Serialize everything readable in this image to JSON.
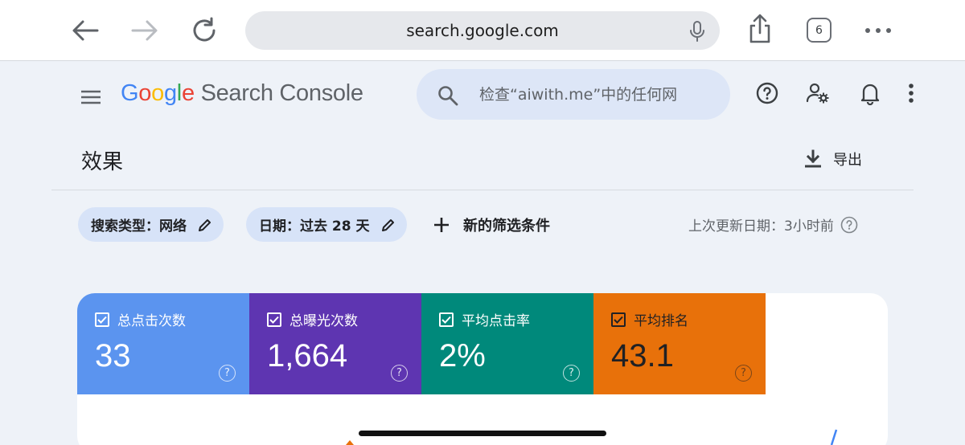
{
  "browser": {
    "url": "search.google.com",
    "tab_count": "6"
  },
  "header": {
    "logo_google": "Google",
    "logo_product": "Search Console",
    "search_placeholder": "检查“aiwith.me”中的任何网址"
  },
  "page": {
    "title": "效果",
    "export_label": "导出"
  },
  "filters": {
    "search_type": "搜索类型：网络",
    "date": "日期：过去 28 天",
    "add_filter": "新的筛选条件",
    "last_updated": "上次更新日期：3小时前"
  },
  "metrics": [
    {
      "label": "总点击次数",
      "value": "33",
      "color": "#5b94ef"
    },
    {
      "label": "总曝光次数",
      "value": "1,664",
      "color": "#5e35b1"
    },
    {
      "label": "平均点击率",
      "value": "2%",
      "color": "#00897b"
    },
    {
      "label": "平均排名",
      "value": "43.1",
      "color": "#e8710a"
    }
  ]
}
